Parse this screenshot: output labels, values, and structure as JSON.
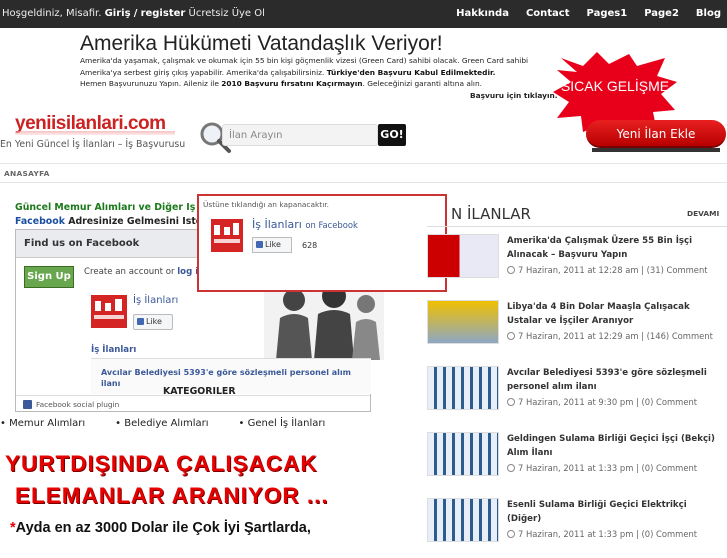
{
  "topbar": {
    "welcome_pre": "Hoşgeldiniz, Misafir.",
    "login": "Giriş",
    "sep": "/",
    "register": "register",
    "signup_text": "Ücretsiz Üye Ol",
    "nav": [
      "Hakkında",
      "Contact",
      "Pages1",
      "Page2",
      "Blog"
    ]
  },
  "ad": {
    "headline": "Amerika Hükümeti Vatandaşlık Veriyor!",
    "body1": "Amerika'da yaşamak, çalışmak ve okumak için 55 bin kişi göçmenlik vizesi (Green Card) sahibi  olacak. Green Card sahibi Amerika'ya serbest giriş çıkış yapabilir. Amerika'da çalışabilirsiniz.",
    "body_bold1": "Türkiye'den Başvuru Kabul Edilmektedir.",
    "body2": "Hemen Başvurunuzu Yapın. Aileniz ile",
    "body_bold2": "2010 Başvuru fırsatını Kaçırmayın",
    "body3": ". Geleceğinizi garanti altına alın.",
    "cta": "Başvuru için tıklayın.",
    "badge": "SICAK GELİŞME"
  },
  "logo": "yeniisilanlari.com",
  "tagline": "En Yeni Güncel İş İlanları – İş Başvurusu",
  "search": {
    "placeholder": "İlan Arayın",
    "go": "GO!"
  },
  "new_ad": "Yeni İlan Ekle",
  "nav": {
    "home": "ANASAYFA"
  },
  "notice": {
    "line1": "Güncel Memur Alımları ve Diğer İş İlan",
    "line2_link": "Facebook",
    "line2_rest": " Adresinize Gelmesini İster m"
  },
  "fb": {
    "title": "Find us on Facebook",
    "signup": "Sign Up",
    "create": "Create an account or",
    "login": "log in",
    "page_name": "İş İlanları",
    "like": "Like",
    "stream_name": "İş İlanları",
    "post": "Avcılar Belediyesi 5393'e göre sözleşmeli personel alım ilanı",
    "plugin": "Facebook social plugin"
  },
  "categories": {
    "title": "KATEGORILER",
    "items": [
      "Memur Alımları",
      "Belediye Alımları",
      "Genel İş İlanları"
    ]
  },
  "banner": {
    "line1": "YURTDIŞINDA ÇALIŞACAK",
    "line2": "ELEMANLAR ARANIYOR ...",
    "star": "*",
    "line3": "Ayda en az 3000 Dolar ile Çok İyi Şartlarda,"
  },
  "popup": {
    "message": "Üstüne tıklandığı an kapanacaktır.",
    "name": "İş İlanları",
    "on": "on Facebook",
    "like": "Like",
    "count": "628"
  },
  "recent": {
    "title": "N İLANLAR",
    "more": "DEVAMI",
    "articles": [
      {
        "title": "Amerika'da Çalışmak Üzere 55 Bin İşçi Alınacak – Başvuru Yapın",
        "date": "7 Haziran, 2011 at 12:28 am",
        "comments": "(31) Comment"
      },
      {
        "title": "Libya'da 4 Bin Dolar Maaşla Çalışacak Ustalar ve İşçiler Aranıyor",
        "date": "7 Haziran, 2011 at 12:29 am",
        "comments": "(146) Comment"
      },
      {
        "title": "Avcılar Belediyesi 5393'e göre sözleşmeli personel alım ilanı",
        "date": "7 Haziran, 2011 at 9:30 pm",
        "comments": "(0) Comment"
      },
      {
        "title": "Geldingen Sulama Birliği Geçici İşçi (Bekçi) Alım İlanı",
        "date": "7 Haziran, 2011 at 1:33 pm",
        "comments": "(0) Comment"
      },
      {
        "title": "Esenli Sulama Birliği Geçici Elektrikçi (Diğer)",
        "date": "7 Haziran, 2011 at 1:33 pm",
        "comments": "(0) Comment"
      }
    ]
  }
}
